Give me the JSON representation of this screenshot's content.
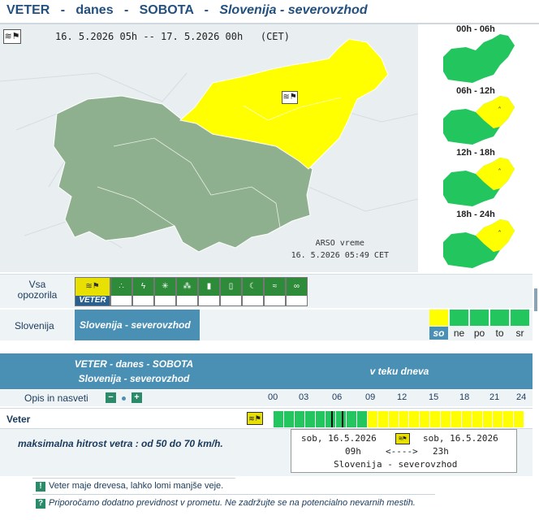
{
  "header": {
    "title_parts": [
      "VETER",
      "-",
      "danes",
      "-",
      "SOBOTA",
      "-",
      "Slovenija - severovzhod"
    ]
  },
  "map": {
    "range_text": "16. 5.2026 05h -- 17. 5.2026 00h   (CET)",
    "credit_line1": "ARSO vreme",
    "credit_line2": "16. 5.2026  05:49 CET",
    "colors": {
      "green": "#70c070",
      "yellow": "#ffff00",
      "gray_green": "#8fb08f"
    }
  },
  "slots": [
    {
      "label": "00h - 06h"
    },
    {
      "label": "06h - 12h"
    },
    {
      "label": "12h - 18h"
    },
    {
      "label": "18h - 24h"
    }
  ],
  "filter": {
    "label": "Vsa opozorila",
    "active_caption": "VETER",
    "icons": [
      "wind-icon",
      "rain-icon",
      "thunder-icon",
      "snow-icon",
      "hail-icon",
      "heat-icon",
      "cold-icon",
      "fog-icon",
      "flood-icon",
      "link-icon"
    ]
  },
  "region": {
    "label": "Slovenija",
    "tab": "Slovenija - severovzhod",
    "days": [
      {
        "name": "so",
        "color": "#ffff00",
        "selected": true
      },
      {
        "name": "ne",
        "color": "#22c55e",
        "selected": false
      },
      {
        "name": "po",
        "color": "#22c55e",
        "selected": false
      },
      {
        "name": "to",
        "color": "#22c55e",
        "selected": false
      },
      {
        "name": "sr",
        "color": "#22c55e",
        "selected": false
      }
    ]
  },
  "table": {
    "head_line1": "VETER - danes - SOBOTA",
    "head_line2": "Slovenija - severovzhod",
    "head_right": "v teku dneva",
    "opis": "Opis in nasveti",
    "hours": [
      "00",
      "03",
      "06",
      "09",
      "12",
      "15",
      "18",
      "21",
      "24"
    ],
    "row_label": "Veter",
    "timeline": [
      {
        "from": 0,
        "to": 9,
        "color": "#22c55e"
      },
      {
        "from": 9,
        "to": 24,
        "color": "#ffff00"
      }
    ],
    "now_hour": 5.5,
    "current_hour_marker": 6.5,
    "description": "maksimalna hitrost vetra : od 50 do 70 km/h.",
    "period": {
      "start_date": "sob, 16.5.2026",
      "end_date": "sob, 16.5.2026",
      "start_hour": "09h",
      "arrow": "<---->",
      "end_hour": "23h",
      "region": "Slovenija - severovzhod"
    }
  },
  "notes": [
    {
      "icon": "!",
      "text": "Veter maje drevesa, lahko lomi manjše veje."
    },
    {
      "icon": "?",
      "text": "Priporočamo dodatno previdnost v prometu. Ne zadržujte se na potencialno nevarnih mestih."
    }
  ]
}
